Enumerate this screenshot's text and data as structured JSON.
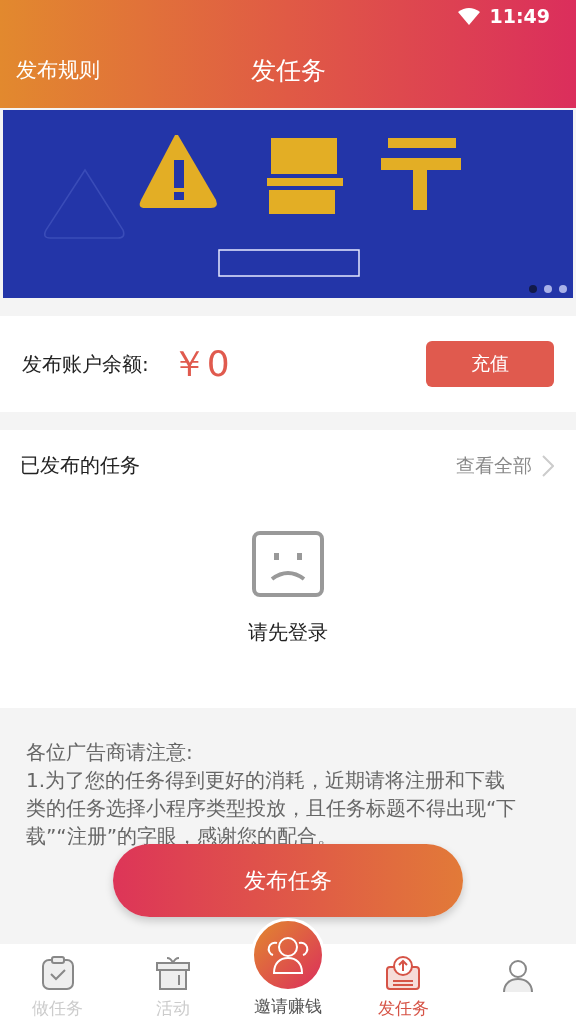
{
  "status_bar": {
    "time": "11:49"
  },
  "header": {
    "left_link": "发布规则",
    "title": "发任务"
  },
  "banner": {
    "kind": "picture",
    "pager": [
      {
        "selected": true
      },
      {
        "selected": false
      },
      {
        "selected": false
      }
    ]
  },
  "balance": {
    "label": "发布账户余额:",
    "amount": "￥0",
    "button": "充值"
  },
  "published": {
    "title": "已发布的任务",
    "view_all": "查看全部",
    "empty_text": "请先登录"
  },
  "notice": {
    "heading": "各位广告商请注意:",
    "body": "1.为了您的任务得到更好的消耗，近期请将注册和下载类的任务选择小程序类型投放，且任务标题不得出现“下载”“注册”的字眼，感谢您的配合。"
  },
  "publish_button": "发布任务",
  "tabs": [
    {
      "kind": "clipboard",
      "label": "做任务",
      "selected": false
    },
    {
      "kind": "gift",
      "label": "活动",
      "selected": false
    },
    {
      "kind": "invite",
      "label": "邀请赚钱",
      "selected": false
    },
    {
      "kind": "upload",
      "label": "发任务",
      "selected": true
    },
    {
      "kind": "person",
      "selected": false
    }
  ]
}
